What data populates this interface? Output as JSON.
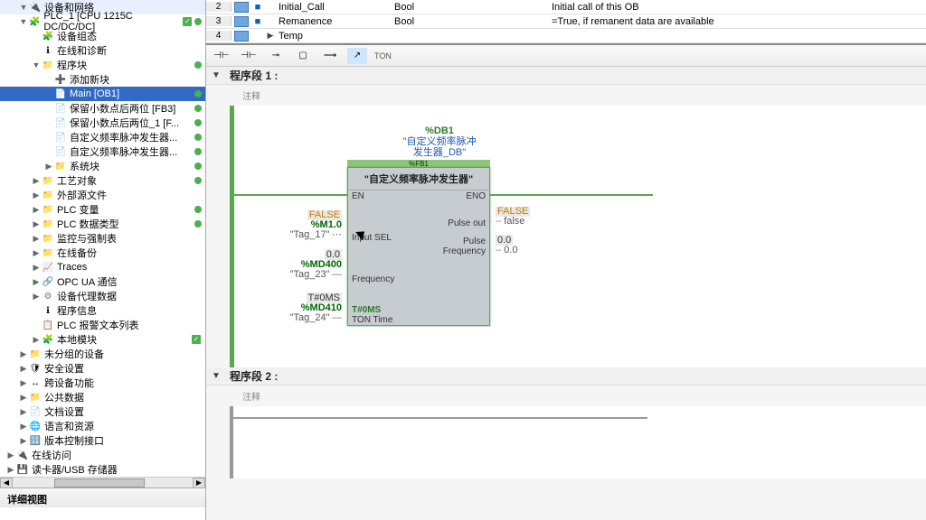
{
  "sidebar": {
    "items": [
      {
        "indent": 1,
        "exp": "▼",
        "icon": "🔌",
        "cls": "",
        "label": "设备和网络",
        "chk": "",
        "dot": ""
      },
      {
        "indent": 1,
        "exp": "▼",
        "icon": "🧩",
        "cls": "",
        "label": "PLC_1 [CPU 1215C DC/DC/DC]",
        "chk": "✓",
        "dot": "g"
      },
      {
        "indent": 2,
        "exp": "",
        "icon": "🧩",
        "cls": "",
        "label": "设备组态",
        "chk": "",
        "dot": ""
      },
      {
        "indent": 2,
        "exp": "",
        "icon": "ℹ",
        "cls": "",
        "label": "在线和诊断",
        "chk": "",
        "dot": ""
      },
      {
        "indent": 2,
        "exp": "▼",
        "icon": "📁",
        "cls": "ic-folder",
        "label": "程序块",
        "chk": "",
        "dot": "g"
      },
      {
        "indent": 3,
        "exp": "",
        "icon": "➕",
        "cls": "",
        "label": "添加新块",
        "chk": "",
        "dot": ""
      },
      {
        "indent": 3,
        "exp": "",
        "icon": "📄",
        "cls": "ic-block",
        "label": "Main [OB1]",
        "sel": true,
        "chk": "",
        "dot": "g"
      },
      {
        "indent": 3,
        "exp": "",
        "icon": "📄",
        "cls": "ic-block",
        "label": "保留小数点后两位 [FB3]",
        "chk": "",
        "dot": "g"
      },
      {
        "indent": 3,
        "exp": "",
        "icon": "📄",
        "cls": "ic-block",
        "label": "保留小数点后两位_1 [F...",
        "chk": "",
        "dot": "g"
      },
      {
        "indent": 3,
        "exp": "",
        "icon": "📄",
        "cls": "ic-db",
        "label": "自定义频率脉冲发生器...",
        "chk": "",
        "dot": "g"
      },
      {
        "indent": 3,
        "exp": "",
        "icon": "📄",
        "cls": "ic-db",
        "label": "自定义频率脉冲发生器...",
        "chk": "",
        "dot": "g"
      },
      {
        "indent": 3,
        "exp": "▶",
        "icon": "📁",
        "cls": "ic-folder",
        "label": "系统块",
        "chk": "",
        "dot": "g"
      },
      {
        "indent": 2,
        "exp": "▶",
        "icon": "📁",
        "cls": "ic-folder",
        "label": "工艺对象",
        "chk": "",
        "dot": "g"
      },
      {
        "indent": 2,
        "exp": "▶",
        "icon": "📁",
        "cls": "ic-folder",
        "label": "外部源文件",
        "chk": "",
        "dot": ""
      },
      {
        "indent": 2,
        "exp": "▶",
        "icon": "📁",
        "cls": "ic-folder",
        "label": "PLC 变量",
        "chk": "",
        "dot": "g"
      },
      {
        "indent": 2,
        "exp": "▶",
        "icon": "📁",
        "cls": "ic-folder",
        "label": "PLC 数据类型",
        "chk": "",
        "dot": "g"
      },
      {
        "indent": 2,
        "exp": "▶",
        "icon": "📁",
        "cls": "ic-folder",
        "label": "监控与强制表",
        "chk": "",
        "dot": ""
      },
      {
        "indent": 2,
        "exp": "▶",
        "icon": "📁",
        "cls": "ic-folder",
        "label": "在线备份",
        "chk": "",
        "dot": ""
      },
      {
        "indent": 2,
        "exp": "▶",
        "icon": "📈",
        "cls": "",
        "label": "Traces",
        "chk": "",
        "dot": ""
      },
      {
        "indent": 2,
        "exp": "▶",
        "icon": "🔗",
        "cls": "",
        "label": "OPC UA 通信",
        "chk": "",
        "dot": ""
      },
      {
        "indent": 2,
        "exp": "▶",
        "icon": "⚙",
        "cls": "ic-gear",
        "label": "设备代理数据",
        "chk": "",
        "dot": ""
      },
      {
        "indent": 2,
        "exp": "",
        "icon": "ℹ",
        "cls": "",
        "label": "程序信息",
        "chk": "",
        "dot": ""
      },
      {
        "indent": 2,
        "exp": "",
        "icon": "📋",
        "cls": "",
        "label": "PLC 报警文本列表",
        "chk": "",
        "dot": ""
      },
      {
        "indent": 2,
        "exp": "▶",
        "icon": "🧩",
        "cls": "",
        "label": "本地模块",
        "chk": "✓",
        "dot": ""
      },
      {
        "indent": 1,
        "exp": "▶",
        "icon": "📁",
        "cls": "ic-folder",
        "label": "未分组的设备",
        "chk": "",
        "dot": ""
      },
      {
        "indent": 1,
        "exp": "▶",
        "icon": "🛡",
        "cls": "",
        "label": "安全设置",
        "chk": "",
        "dot": ""
      },
      {
        "indent": 1,
        "exp": "▶",
        "icon": "↔",
        "cls": "",
        "label": "跨设备功能",
        "chk": "",
        "dot": ""
      },
      {
        "indent": 1,
        "exp": "▶",
        "icon": "📁",
        "cls": "ic-folder",
        "label": "公共数据",
        "chk": "",
        "dot": ""
      },
      {
        "indent": 1,
        "exp": "▶",
        "icon": "📄",
        "cls": "",
        "label": "文档设置",
        "chk": "",
        "dot": ""
      },
      {
        "indent": 1,
        "exp": "▶",
        "icon": "🌐",
        "cls": "",
        "label": "语言和资源",
        "chk": "",
        "dot": ""
      },
      {
        "indent": 1,
        "exp": "▶",
        "icon": "🔢",
        "cls": "",
        "label": "版本控制接口",
        "chk": "",
        "dot": ""
      },
      {
        "indent": 0,
        "exp": "▶",
        "icon": "🔌",
        "cls": "",
        "label": "在线访问",
        "chk": "",
        "dot": ""
      },
      {
        "indent": 0,
        "exp": "▶",
        "icon": "💾",
        "cls": "",
        "label": "读卡器/USB 存储器",
        "chk": "",
        "dot": ""
      }
    ],
    "detail_title": "详细视图"
  },
  "var_table": {
    "rows": [
      {
        "n": "2",
        "bul": "■",
        "exp": "",
        "name": "Initial_Call",
        "type": "Bool",
        "comment": "Initial call of this OB"
      },
      {
        "n": "3",
        "bul": "■",
        "exp": "",
        "name": "Remanence",
        "type": "Bool",
        "comment": "=True, if remanent data are available"
      },
      {
        "n": "4",
        "bul": "",
        "exp": "▶",
        "name": "Temp",
        "type": "",
        "comment": ""
      }
    ]
  },
  "toolbar": {
    "btns": [
      "⊣⊢",
      "⊣⊢",
      "⊸",
      "▢",
      "⟶",
      "↗"
    ],
    "timer": "TON"
  },
  "seg1": {
    "title": "程序段 1 :",
    "comment": "注释"
  },
  "seg2": {
    "title": "程序段 2 :",
    "comment": "注释"
  },
  "fb": {
    "db_addr": "%DB1",
    "db_name": "\"自定义频率脉冲\n发生器_DB\"",
    "fb_addr": "%FB1",
    "fb_name": "\"自定义频率脉冲发生器\"",
    "pins": {
      "en": "EN",
      "eno": "ENO",
      "in1": "Input SEL",
      "in2": "Frequency",
      "in3": "TON Time",
      "in3_val": "T#0MS",
      "out1": "Pulse out",
      "out2": "Pulse\nFrequency"
    }
  },
  "operands": {
    "sel": {
      "bool": "FALSE",
      "addr": "%M1.0",
      "name": "\"Tag_17\""
    },
    "freq": {
      "val": "0.0",
      "addr": "%MD400",
      "name": "\"Tag_23\""
    },
    "ton": {
      "val": "T#0MS",
      "addr": "%MD410",
      "name": "\"Tag_24\""
    },
    "pout": {
      "bool": "FALSE",
      "name": "false"
    },
    "pfrq": {
      "val": "0.0",
      "extra": "0.0"
    }
  }
}
